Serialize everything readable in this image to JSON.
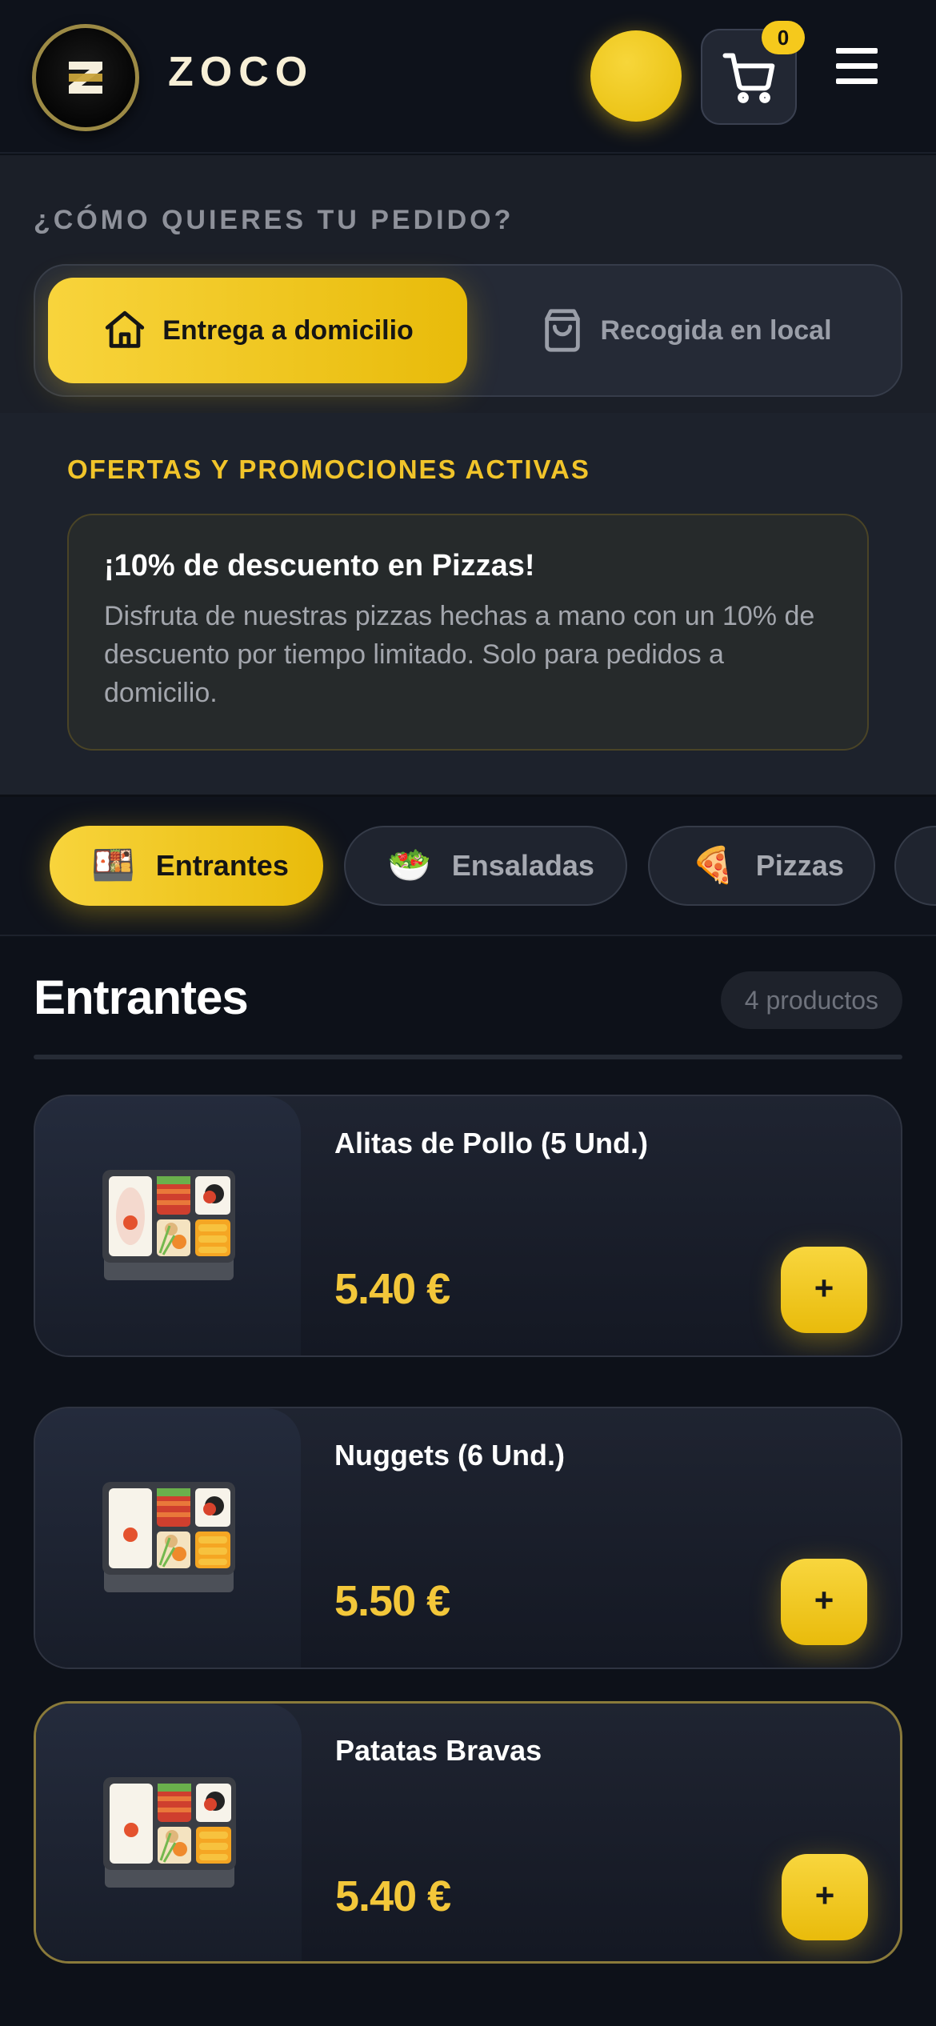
{
  "header": {
    "brand": "ZOCO",
    "cart_count": "0"
  },
  "order_type": {
    "title": "¿CÓMO QUIERES TU PEDIDO?",
    "delivery_label": "Entrega a domicilio",
    "pickup_label": "Recogida en local",
    "selected": "delivery"
  },
  "promos": {
    "heading": "OFERTAS Y PROMOCIONES ACTIVAS",
    "items": [
      {
        "title": "¡10% de descuento en Pizzas!",
        "description": "Disfruta de nuestras pizzas hechas a mano con un 10% de descuento por tiempo limitado. Solo para pedidos a domicilio."
      }
    ]
  },
  "categories": [
    {
      "icon": "🍱",
      "label": "Entrantes",
      "active": true
    },
    {
      "icon": "🥗",
      "label": "Ensaladas",
      "active": false
    },
    {
      "icon": "🍕",
      "label": "Pizzas",
      "active": false
    }
  ],
  "section": {
    "title": "Entrantes",
    "count_label": "4 productos"
  },
  "products": [
    {
      "name": "Alitas de Pollo (5 Und.)",
      "price": "5.40 €",
      "add_label": "+"
    },
    {
      "name": "Nuggets (6 Und.)",
      "price": "5.50 €",
      "add_label": "+"
    },
    {
      "name": "Patatas Bravas",
      "price": "5.40 €",
      "add_label": "+"
    }
  ],
  "colors": {
    "accent": "#f5c91c",
    "background": "#0d1119",
    "price": "#f3c73a"
  }
}
